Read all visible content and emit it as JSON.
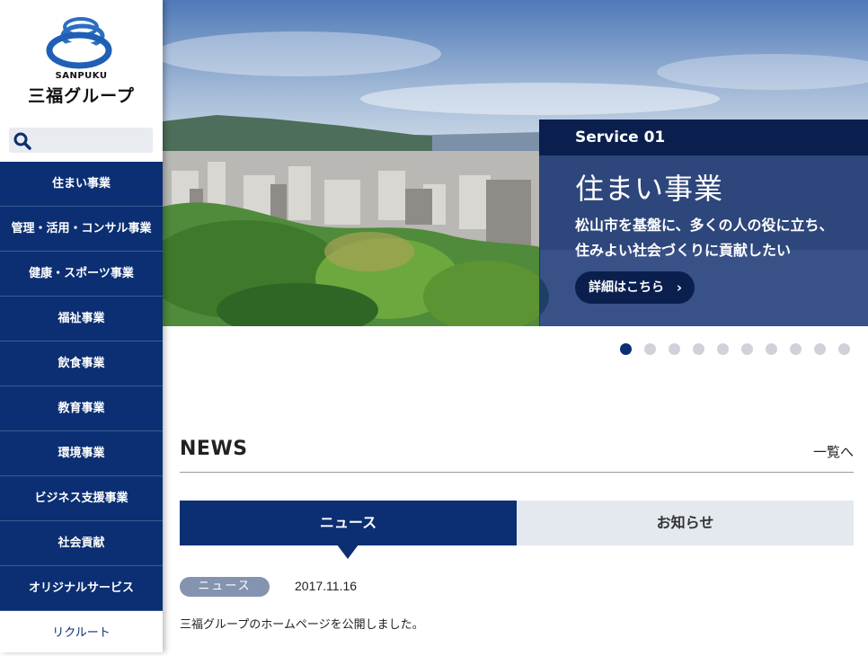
{
  "logo": {
    "sub": "SANPUKU",
    "title": "三福グループ"
  },
  "search": {
    "placeholder": "",
    "value": ""
  },
  "nav": {
    "items": [
      "住まい事業",
      "管理・活用・コンサル事業",
      "健康・スポーツ事業",
      "福祉事業",
      "飲食事業",
      "教育事業",
      "環境事業",
      "ビジネス支援事業",
      "社会貢献",
      "オリジナルサービス"
    ],
    "recruit": "リクルート"
  },
  "hero": {
    "service": "Service 01",
    "title": "住まい事業",
    "desc_line1": "松山市を基盤に、多くの人の役に立ち、",
    "desc_line2": "住みよい社会づくりに貢献したい",
    "button": "詳細はこちら",
    "slide_count": 10,
    "active_slide": 1
  },
  "news": {
    "title": "NEWS",
    "more": "一覧へ",
    "tabs": [
      "ニュース",
      "お知らせ"
    ],
    "items": [
      {
        "category": "ニュース",
        "date": "2017.11.16",
        "text": "三福グループのホームページを公開しました。"
      }
    ]
  },
  "colors": {
    "brand": "#0b2f72",
    "brand_dark": "#0a1f4e",
    "tab_inactive": "#e4e8ef",
    "badge": "#8493b0"
  }
}
